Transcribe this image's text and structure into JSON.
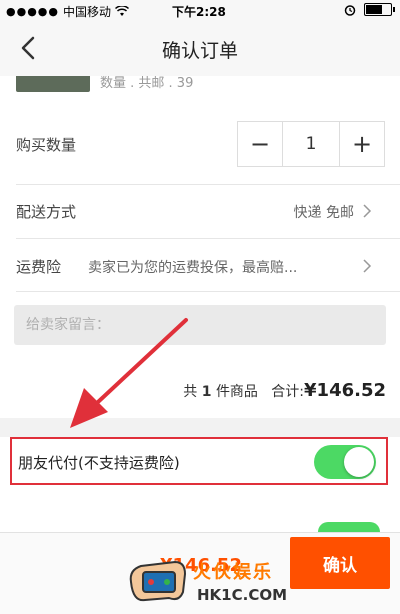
{
  "status_bar": {
    "carrier": "中国移动",
    "time": "下午2:28"
  },
  "nav": {
    "title": "确认订单"
  },
  "product": {
    "partial_text": "数量 . 共邮 . 39"
  },
  "quantity": {
    "label": "购买数量",
    "minus": "−",
    "value": "1",
    "plus": "+"
  },
  "delivery": {
    "label": "配送方式",
    "value": "快递 免邮"
  },
  "insurance": {
    "label": "运费险",
    "value": "卖家已为您的运费投保，最高赔..."
  },
  "message": {
    "placeholder": "给卖家留言："
  },
  "summary": {
    "prefix": "共",
    "count": "1",
    "suffix": "件商品",
    "total_label": "合计:",
    "total": "¥146.52"
  },
  "friend_pay": {
    "label": "朋友代付(不支持运费险)",
    "enabled": true
  },
  "bottom": {
    "total_peek": "¥146.52",
    "confirm": "确认"
  },
  "watermark": {
    "name": "火伙娱乐",
    "site": "HK1C.COM"
  },
  "colors": {
    "accent": "#ff5000",
    "toggle_on": "#4cd964",
    "highlight_border": "#e0303a"
  },
  "icons": [
    "wifi-icon",
    "alarm-icon",
    "battery-icon",
    "back-arrow-icon",
    "chevron-right-icon",
    "annotation-arrow-icon"
  ]
}
